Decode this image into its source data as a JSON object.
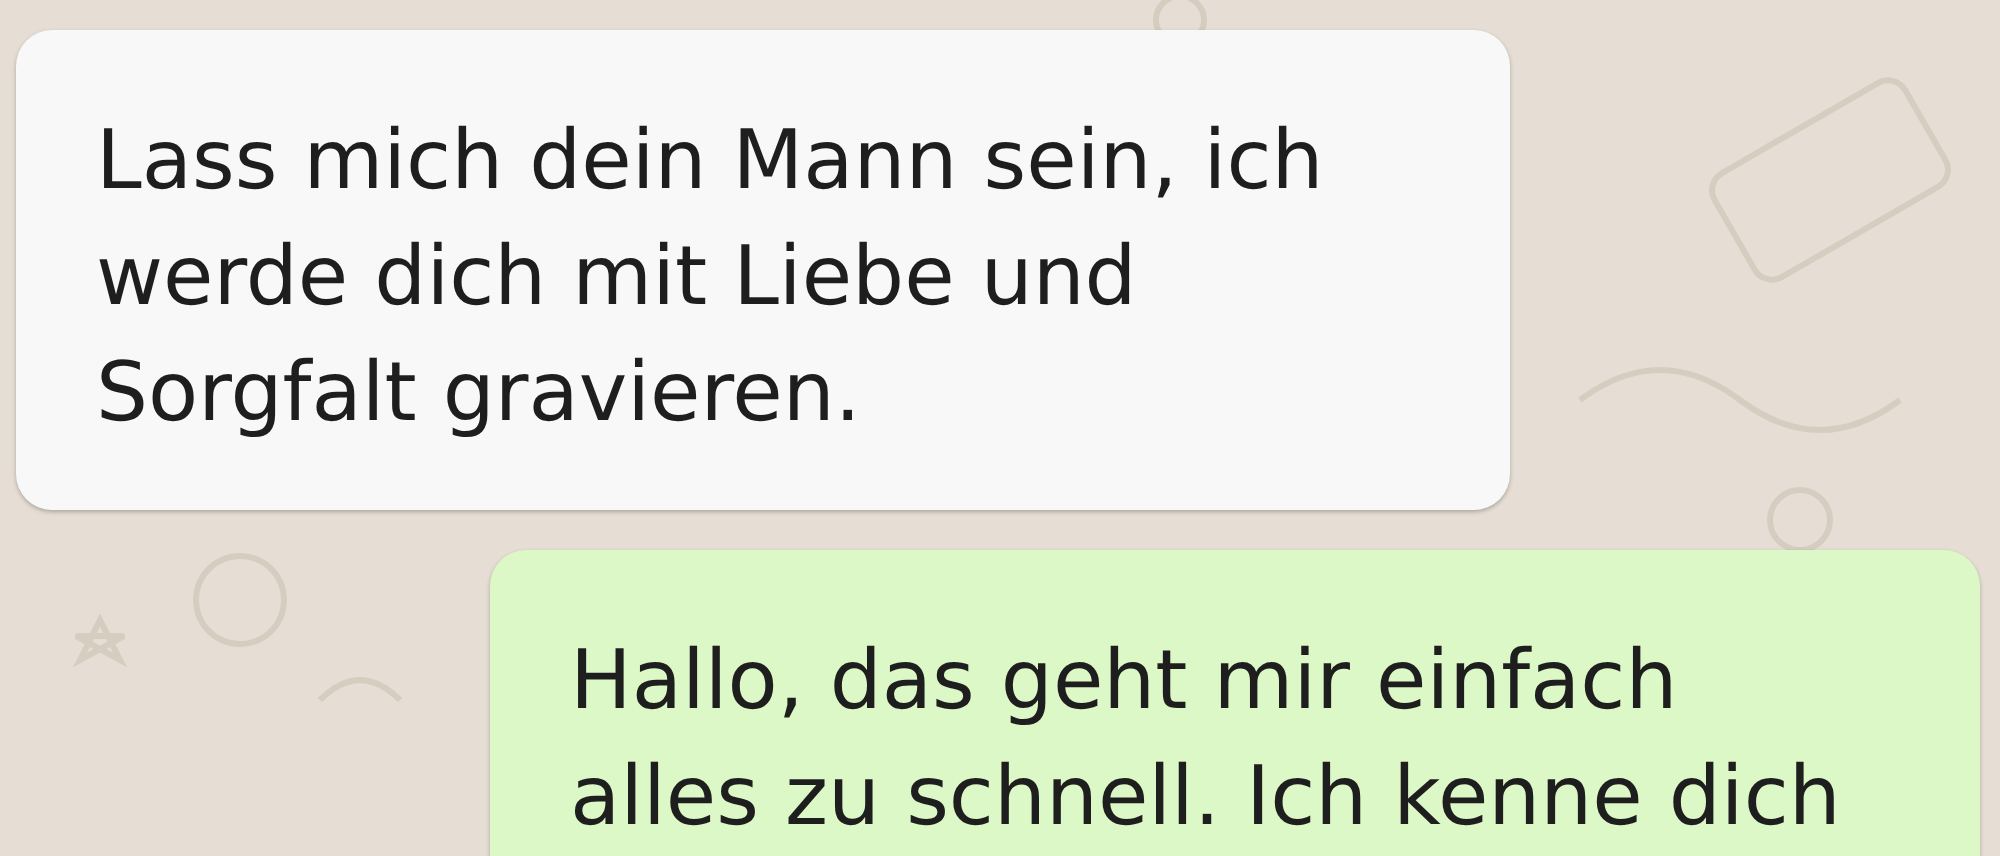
{
  "messages": [
    {
      "kind": "incoming",
      "text": "Lass mich dein Mann sein, ich\nwerde dich mit Liebe und\nSorgfalt gravieren."
    },
    {
      "kind": "outgoing",
      "text": "Hallo, das geht mir einfach\nalles zu schnell. Ich kenne dich"
    }
  ]
}
